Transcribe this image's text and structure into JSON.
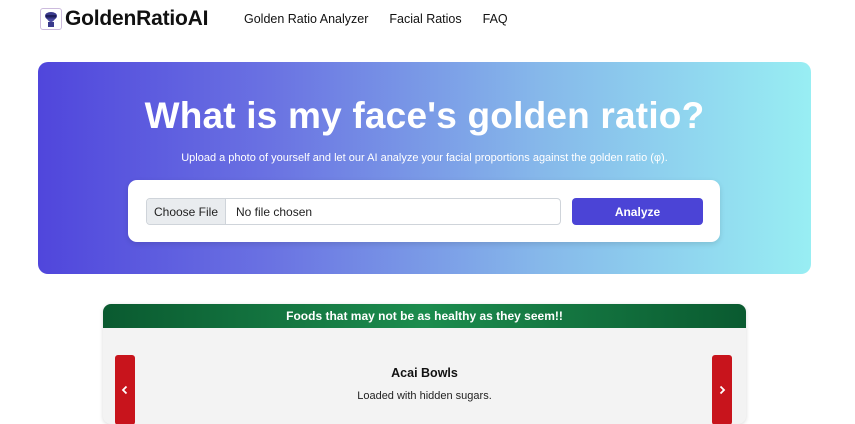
{
  "brand": {
    "name": "GoldenRatioAI",
    "logo_icon": "masked-face-icon"
  },
  "nav": {
    "items": [
      "Golden Ratio Analyzer",
      "Facial Ratios",
      "FAQ"
    ]
  },
  "hero": {
    "title": "What is my face's golden ratio?",
    "subtitle": "Upload a photo of yourself and let our AI analyze your facial proportions against the golden ratio (φ).",
    "file_button": "Choose File",
    "file_status": "No file chosen",
    "analyze_label": "Analyze"
  },
  "promo": {
    "header": "Foods that may not be as healthy as they seem!!",
    "item_title": "Acai Bowls",
    "item_desc": "Loaded with hidden sugars.",
    "prev_icon": "chevron-left-icon",
    "next_icon": "chevron-right-icon"
  },
  "colors": {
    "accent": "#4b44d6",
    "promo_green": "#1c8c4e",
    "arrow_red": "#c8141c"
  }
}
